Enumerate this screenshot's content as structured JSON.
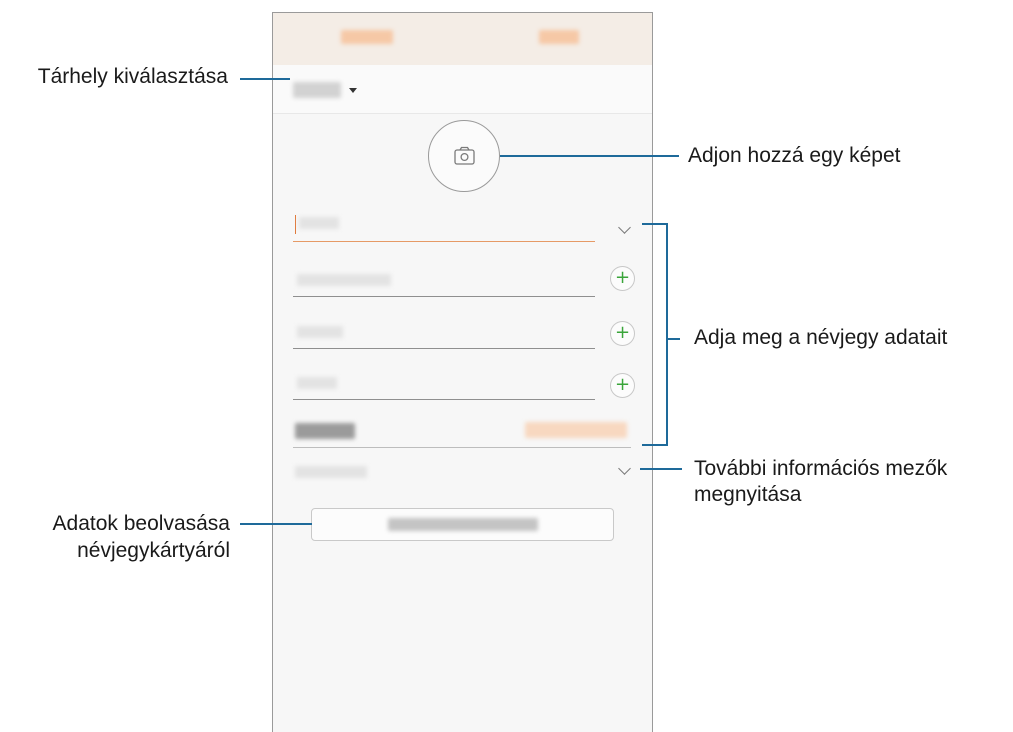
{
  "callouts": {
    "storage": "Tárhely kiválasztása",
    "add_picture": "Adjon hozzá egy képet",
    "enter_details": "Adja meg a névjegy adatait",
    "more_fields_line1": "További információs mezők",
    "more_fields_line2": "megnyitása",
    "scan_line1": "Adatok beolvasása",
    "scan_line2": "névjegykártyáról"
  },
  "icons": {
    "camera": "camera-icon",
    "plus": "+",
    "dropdown": "caret-down-icon",
    "expand": "chevron-down-icon"
  },
  "colors": {
    "accent_orange": "#e07a3c",
    "plus_green": "#3aa53a",
    "callout_line": "#1e6a9a"
  }
}
